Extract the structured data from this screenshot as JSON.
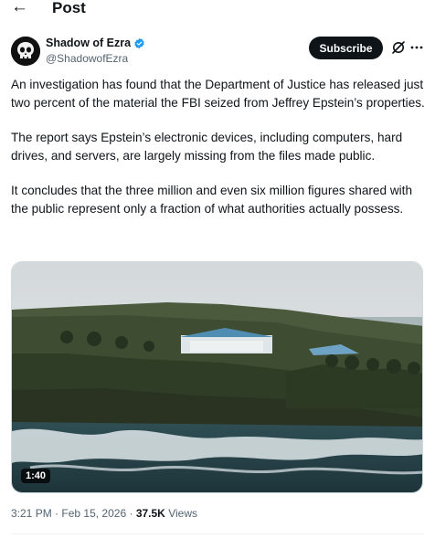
{
  "header": {
    "title": "Post",
    "back_icon": "arrow-left-icon"
  },
  "author": {
    "name": "Shadow of Ezra",
    "handle": "@ShadowofEzra",
    "verified": true,
    "verified_color": "#1d9bf0",
    "avatar_icon": "skull-avatar"
  },
  "actions": {
    "subscribe_label": "Subscribe",
    "grok_icon": "grok-icon",
    "more_icon": "more-icon"
  },
  "tweet": {
    "paragraphs": [
      "An investigation has found that the Department of Justice has released just two percent of the material the FBI seized from Jeffrey Epstein’s properties.",
      "The report says Epstein’s electronic devices, including computers, hard drives, and servers, are largely missing from the files made public.",
      "It concludes that the three million and even six million figures shared with the public represent only a fraction of what authorities actually possess."
    ]
  },
  "media": {
    "type": "video",
    "duration": "1:40"
  },
  "meta": {
    "time": "3:21 PM",
    "date": "Feb 15, 2026",
    "views_count": "37.5K",
    "views_label": "Views",
    "separator": "·"
  }
}
